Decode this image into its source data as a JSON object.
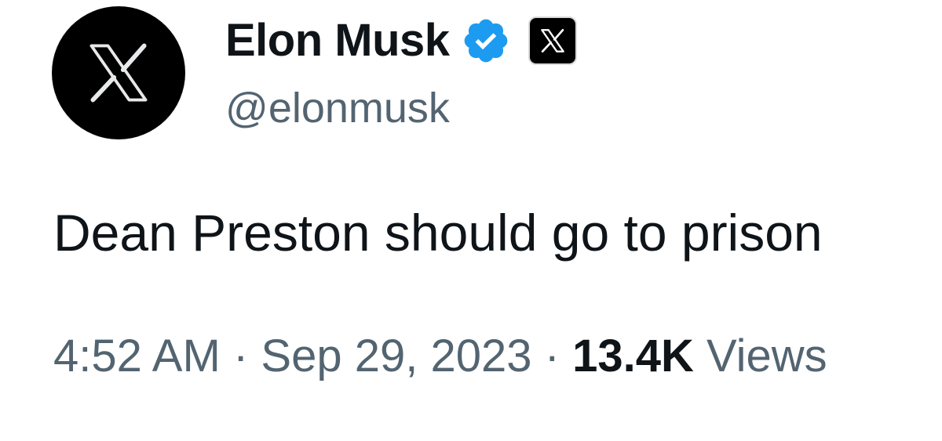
{
  "author": {
    "display_name": "Elon Musk",
    "handle": "@elonmusk",
    "avatar_icon": "x-logo-icon",
    "verified_icon": "verified-badge-icon",
    "affiliate_icon": "x-logo-icon",
    "verified_color": "#1d9bf0"
  },
  "tweet": {
    "text": "Dean Preston should go to prison"
  },
  "meta": {
    "time": "4:52 AM",
    "separator": "·",
    "date": "Sep 29, 2023",
    "views_count": "13.4K",
    "views_label": "Views"
  },
  "colors": {
    "primary_text": "#0f1419",
    "secondary_text": "#536471",
    "background": "#ffffff"
  }
}
